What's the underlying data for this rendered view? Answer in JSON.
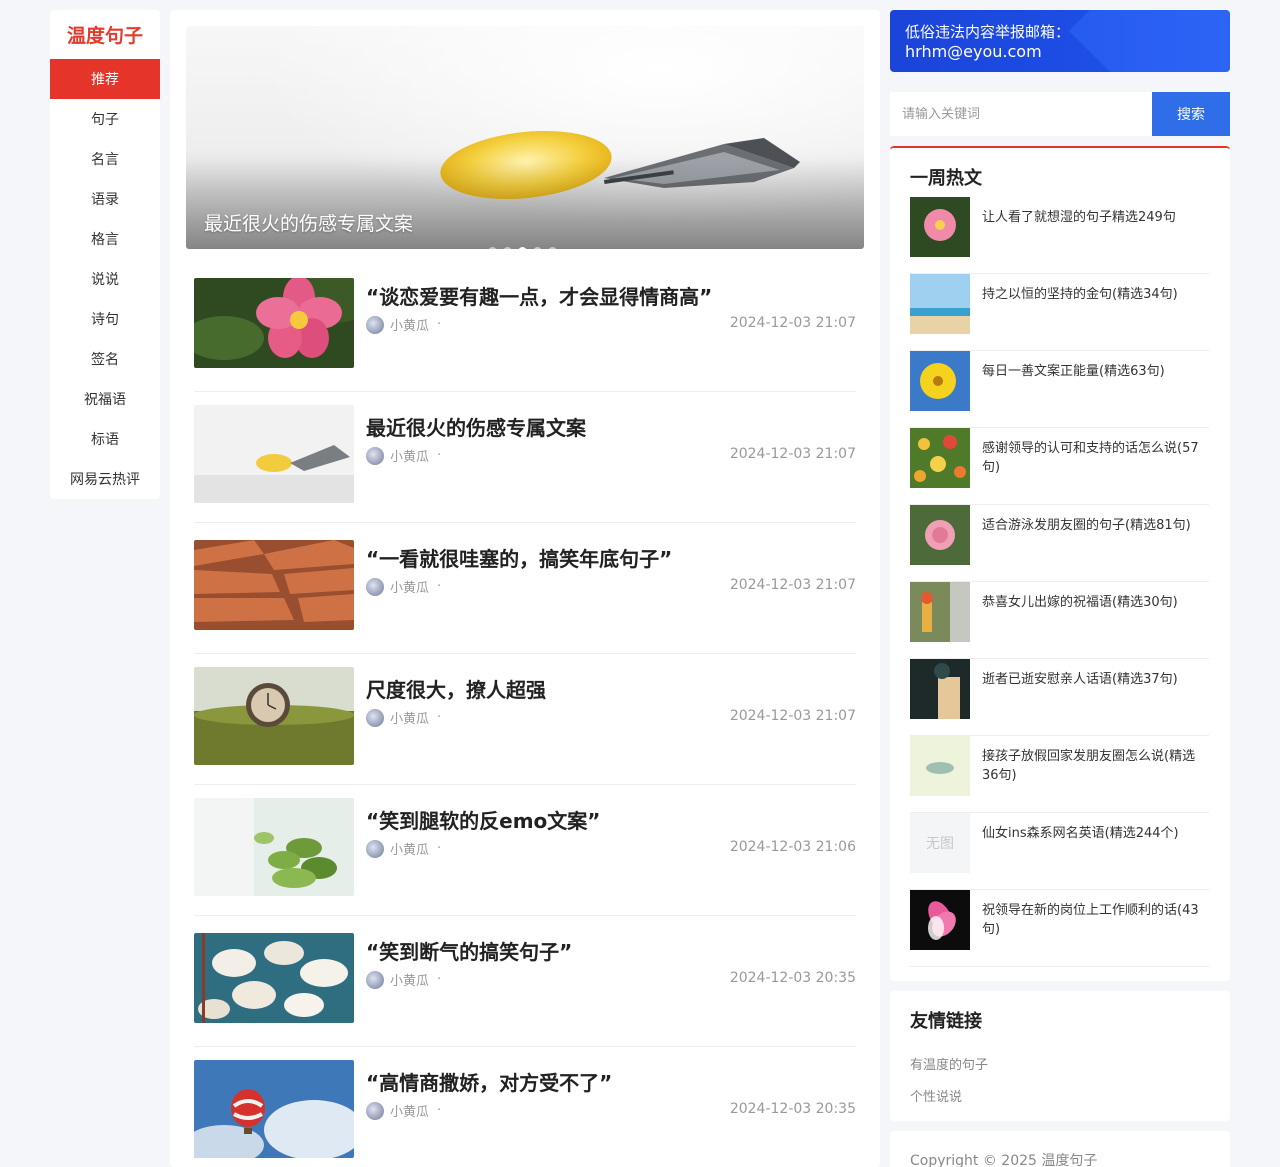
{
  "site": {
    "logo": "温度句子"
  },
  "nav": {
    "items": [
      {
        "label": "推荐",
        "active": true
      },
      {
        "label": "句子"
      },
      {
        "label": "名言"
      },
      {
        "label": "语录"
      },
      {
        "label": "格言"
      },
      {
        "label": "说说"
      },
      {
        "label": "诗句"
      },
      {
        "label": "签名"
      },
      {
        "label": "祝福语"
      },
      {
        "label": "标语"
      },
      {
        "label": "网易云热评"
      }
    ]
  },
  "banner": {
    "caption": "最近很火的伤感专属文案",
    "slide_count": 5,
    "active_slide": 3
  },
  "articles": [
    {
      "title": "“谈恋爱要有趣一点，才会显得情商高”",
      "author": "小黄瓜",
      "separator": "·",
      "date": "2024-12-03 21:07"
    },
    {
      "title": "最近很火的伤感专属文案",
      "author": "小黄瓜",
      "separator": "·",
      "date": "2024-12-03 21:07"
    },
    {
      "title": "“一看就很哇塞的，搞笑年底句子”",
      "author": "小黄瓜",
      "separator": "·",
      "date": "2024-12-03 21:07"
    },
    {
      "title": "尺度很大，撩人超强",
      "author": "小黄瓜",
      "separator": "·",
      "date": "2024-12-03 21:07"
    },
    {
      "title": "“笑到腿软的反emo文案”",
      "author": "小黄瓜",
      "separator": "·",
      "date": "2024-12-03 21:06"
    },
    {
      "title": "“笑到断气的搞笑句子”",
      "author": "小黄瓜",
      "separator": "·",
      "date": "2024-12-03 20:35"
    },
    {
      "title": "“高情商撒娇，对方受不了”",
      "author": "小黄瓜",
      "separator": "·",
      "date": "2024-12-03 20:35"
    }
  ],
  "report": {
    "line1": "低俗违法内容举报邮箱：",
    "line2": "hrhm@eyou.com"
  },
  "search": {
    "placeholder": "请输入关键词",
    "button": "搜索"
  },
  "hot": {
    "title": "一周热文",
    "no_image_label": "无图",
    "items": [
      {
        "title": "让人看了就想湿的句子精选249句"
      },
      {
        "title": "持之以恒的坚持的金句(精选34句)"
      },
      {
        "title": "每日一善文案正能量(精选63句)"
      },
      {
        "title": "感谢领导的认可和支持的话怎么说(57句)"
      },
      {
        "title": "适合游泳发朋友圈的句子(精选81句)"
      },
      {
        "title": "恭喜女儿出嫁的祝福语(精选30句)"
      },
      {
        "title": "逝者已逝安慰亲人话语(精选37句)"
      },
      {
        "title": "接孩子放假回家发朋友圈怎么说(精选36句)"
      },
      {
        "title": "仙女ins森系网名英语(精选244个)"
      },
      {
        "title": "祝领导在新的岗位上工作顺利的话(43句)"
      }
    ]
  },
  "friends": {
    "title": "友情链接",
    "links": [
      "有温度的句子",
      "个性说说"
    ]
  },
  "footer": {
    "copyright": "Copyright © 2025 温度句子"
  },
  "colors": {
    "accent_red": "#e5352a",
    "search_blue": "#2f6ee8",
    "report_blue": "#1d4ee6"
  }
}
